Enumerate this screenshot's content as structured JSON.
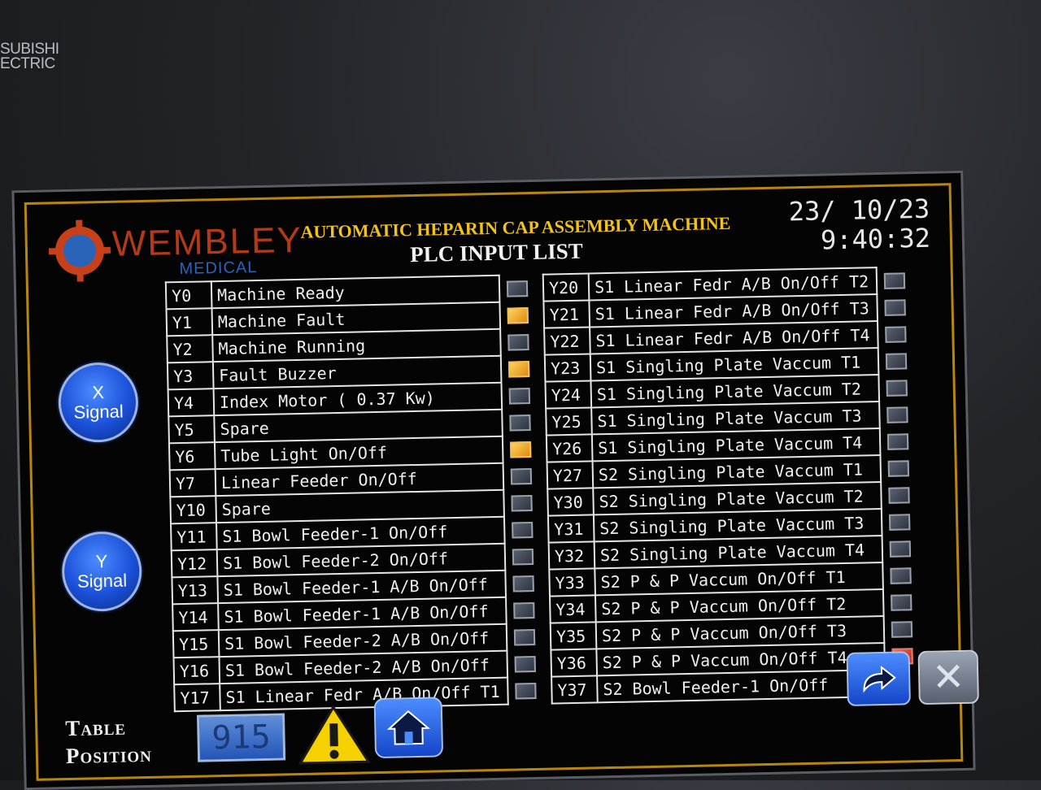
{
  "bezel": {
    "brand_line1": "SUBISHI",
    "brand_line2": "ECTRIC"
  },
  "header": {
    "logo_text": "WEMBLEY",
    "logo_sub": "MEDICAL",
    "machine_title": "AUTOMATIC HEPARIN CAP ASSEMBLY MACHINE",
    "page_title": "PLC INPUT LIST",
    "date": "23/ 10/23",
    "time": "9:40:32"
  },
  "signals": {
    "x_line1": "X",
    "x_line2": "Signal",
    "y_line1": "Y",
    "y_line2": "Signal"
  },
  "left_table": [
    {
      "addr": "Y0",
      "desc": "Machine Ready",
      "state": "off"
    },
    {
      "addr": "Y1",
      "desc": "Machine Fault",
      "state": "on"
    },
    {
      "addr": "Y2",
      "desc": "Machine Running",
      "state": "off"
    },
    {
      "addr": "Y3",
      "desc": "Fault Buzzer",
      "state": "on"
    },
    {
      "addr": "Y4",
      "desc": "Index Motor ( 0.37 Kw)",
      "state": "off"
    },
    {
      "addr": "Y5",
      "desc": "Spare",
      "state": "off"
    },
    {
      "addr": "Y6",
      "desc": "Tube Light On/Off",
      "state": "on"
    },
    {
      "addr": "Y7",
      "desc": "Linear Feeder On/Off",
      "state": "off"
    },
    {
      "addr": "Y10",
      "desc": "Spare",
      "state": "off"
    },
    {
      "addr": "Y11",
      "desc": "S1 Bowl Feeder-1 On/Off",
      "state": "off"
    },
    {
      "addr": "Y12",
      "desc": "S1 Bowl Feeder-2 On/Off",
      "state": "off"
    },
    {
      "addr": "Y13",
      "desc": "S1 Bowl Feeder-1 A/B On/Off",
      "state": "off"
    },
    {
      "addr": "Y14",
      "desc": "S1 Bowl Feeder-1 A/B On/Off",
      "state": "off"
    },
    {
      "addr": "Y15",
      "desc": "S1 Bowl Feeder-2 A/B On/Off",
      "state": "off"
    },
    {
      "addr": "Y16",
      "desc": "S1 Bowl Feeder-2 A/B On/Off",
      "state": "off"
    },
    {
      "addr": "Y17",
      "desc": "S1 Linear Fedr A/B On/Off T1",
      "state": "off"
    }
  ],
  "right_table": [
    {
      "addr": "Y20",
      "desc": "S1 Linear Fedr A/B On/Off T2",
      "state": "off"
    },
    {
      "addr": "Y21",
      "desc": "S1 Linear Fedr A/B On/Off T3",
      "state": "off"
    },
    {
      "addr": "Y22",
      "desc": "S1 Linear Fedr A/B On/Off T4",
      "state": "off"
    },
    {
      "addr": "Y23",
      "desc": "S1 Singling Plate Vaccum T1",
      "state": "off"
    },
    {
      "addr": "Y24",
      "desc": "S1 Singling Plate Vaccum T2",
      "state": "off"
    },
    {
      "addr": "Y25",
      "desc": "S1 Singling Plate Vaccum T3",
      "state": "off"
    },
    {
      "addr": "Y26",
      "desc": "S1 Singling Plate Vaccum T4",
      "state": "off"
    },
    {
      "addr": "Y27",
      "desc": "S2 Singling Plate Vaccum T1",
      "state": "off"
    },
    {
      "addr": "Y30",
      "desc": "S2 Singling Plate Vaccum T2",
      "state": "off"
    },
    {
      "addr": "Y31",
      "desc": "S2 Singling Plate Vaccum T3",
      "state": "off"
    },
    {
      "addr": "Y32",
      "desc": "S2 Singling Plate Vaccum T4",
      "state": "off"
    },
    {
      "addr": "Y33",
      "desc": "S2 P & P Vaccum On/Off T1",
      "state": "off"
    },
    {
      "addr": "Y34",
      "desc": "S2 P & P Vaccum On/Off T2",
      "state": "off"
    },
    {
      "addr": "Y35",
      "desc": "S2 P & P Vaccum On/Off T3",
      "state": "off"
    },
    {
      "addr": "Y36",
      "desc": "S2 P & P Vaccum On/Off T4",
      "state": "red"
    },
    {
      "addr": "Y37",
      "desc": "S2 Bowl Feeder-1 On/Off",
      "state": "none"
    }
  ],
  "footer": {
    "table_position_line1": "Table",
    "table_position_line2": "Position",
    "table_position_value": "915"
  },
  "colors": {
    "title_yellow": "#f2c21b",
    "button_blue": "#1a50d8",
    "lamp_on": "#e08a10",
    "lamp_alarm": "#c0281a",
    "frame_gold": "#b8860b"
  },
  "icons": {
    "warning": "warning-icon",
    "home": "home-icon",
    "next": "next-page-arrow-icon",
    "close": "close-icon"
  }
}
